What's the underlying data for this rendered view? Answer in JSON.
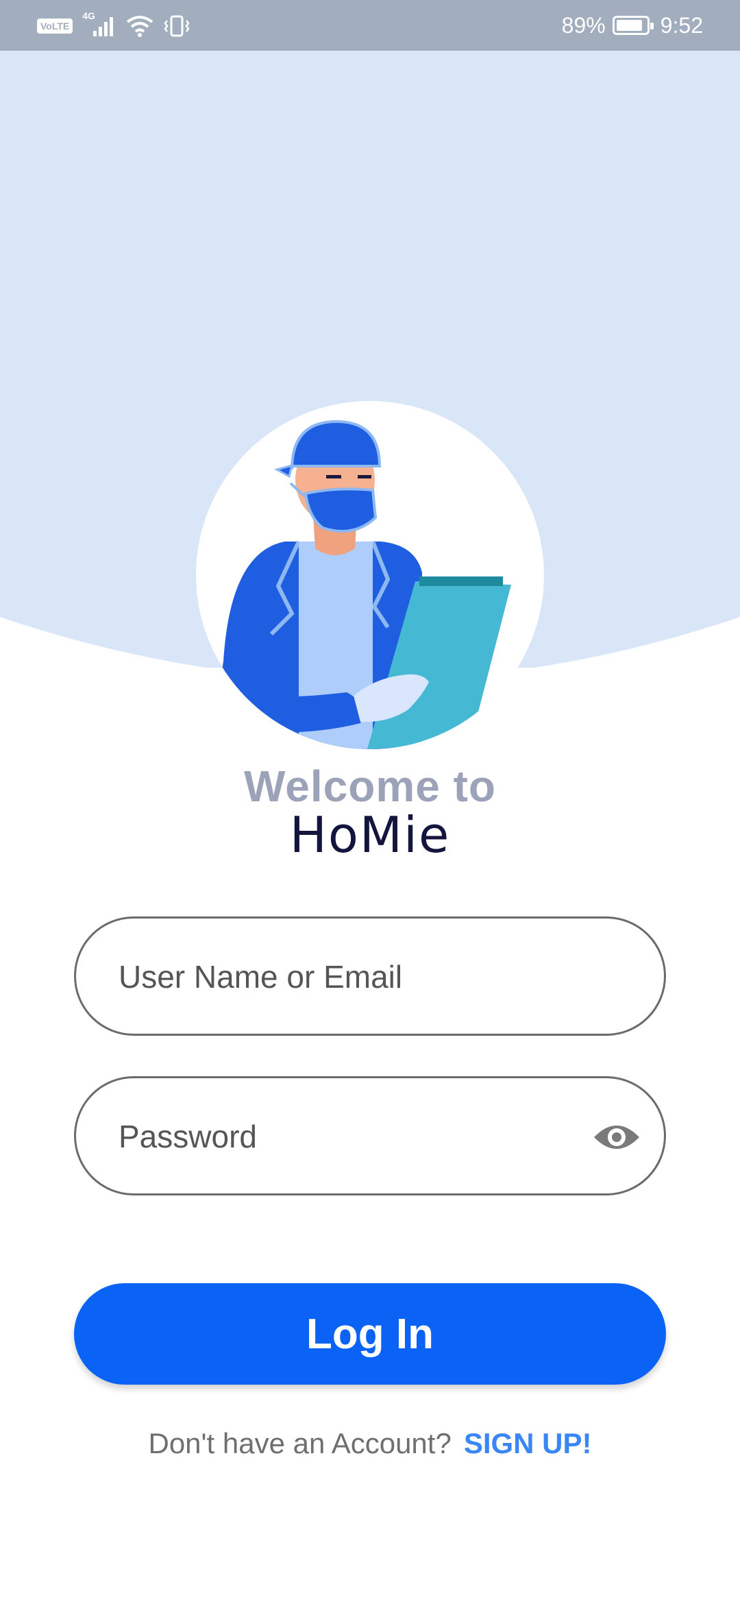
{
  "status_bar": {
    "volte": "VoLTE",
    "network": "4G",
    "battery_percent_text": "89%",
    "battery_level": 0.89,
    "time": "9:52"
  },
  "welcome": {
    "line1": "Welcome to",
    "brand": "HoMie"
  },
  "form": {
    "username_placeholder": "User Name or Email",
    "password_placeholder": "Password",
    "login_label": "Log In"
  },
  "footer": {
    "prompt": "Don't have an Account?",
    "signup_label": "SIGN UP!"
  },
  "colors": {
    "header_bg": "#d8e6f8",
    "primary": "#0b63f5",
    "brand_text": "#13153d",
    "welcome_text": "#9ca3b9",
    "signup_link": "#3a86f5"
  },
  "icons": {
    "password_toggle": "eye-icon",
    "avatar": "doctor-illustration"
  }
}
